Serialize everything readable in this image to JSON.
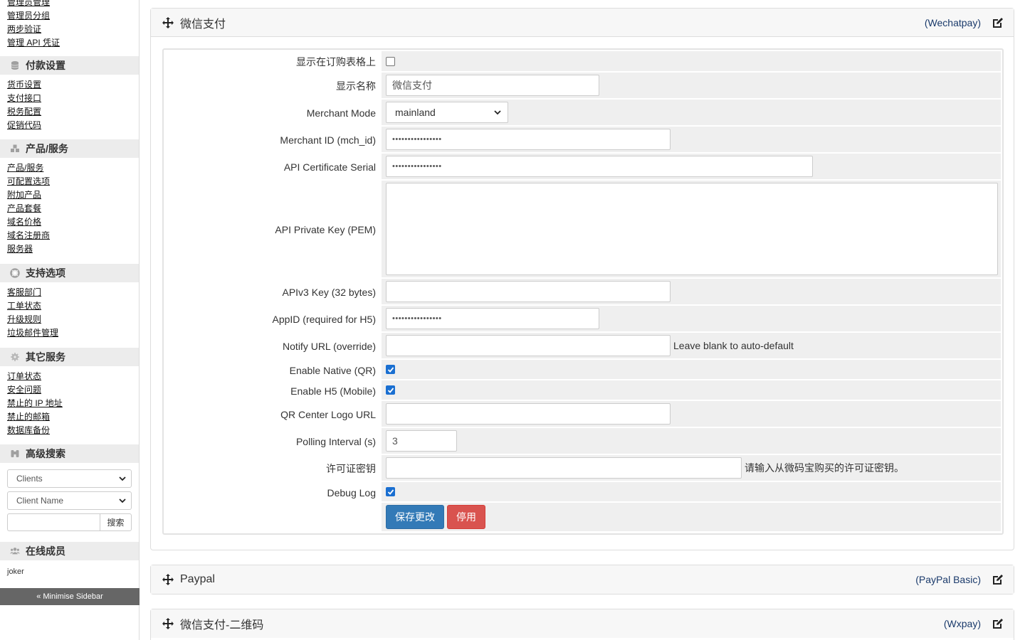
{
  "sidebar": {
    "top_links": [
      "管理员管理",
      "管理员分组",
      "两步验证",
      "管理 API 凭证"
    ],
    "sections": [
      {
        "title": "付款设置",
        "icon": "coins-icon",
        "links": [
          "货币设置",
          "支付接口",
          "税务配置",
          "促销代码"
        ]
      },
      {
        "title": "产品/服务",
        "icon": "cubes-icon",
        "links": [
          "产品/服务",
          "可配置选项",
          "附加产品",
          "产品套餐",
          "域名价格",
          "域名注册商",
          "服务器"
        ]
      },
      {
        "title": "支持选项",
        "icon": "lifebuoy-icon",
        "links": [
          "客服部门",
          "工单状态",
          "升级规则",
          "垃圾邮件管理"
        ]
      },
      {
        "title": "其它服务",
        "icon": "cogs-icon",
        "links": [
          "订单状态",
          "安全问题",
          "禁止的 IP 地址",
          "禁止的邮箱",
          "数据库备份"
        ]
      }
    ],
    "advanced_search": {
      "title": "高级搜索",
      "type_select": "Clients",
      "field_select": "Client Name",
      "search_value": "",
      "search_button": "搜索"
    },
    "online": {
      "title": "在线成员",
      "users": [
        "joker"
      ]
    },
    "minimise": "« Minimise Sidebar"
  },
  "panels": [
    {
      "title": "微信支付",
      "module": "(Wechatpay)"
    },
    {
      "title": "Paypal",
      "module": "(PayPal Basic)"
    },
    {
      "title": "微信支付-二维码",
      "module": "(Wxpay)"
    }
  ],
  "form": {
    "show_on_order_label": "显示在订购表格上",
    "show_on_order": false,
    "display_name_label": "显示名称",
    "display_name": "微信支付",
    "merchant_mode_label": "Merchant Mode",
    "merchant_mode": "mainland",
    "merchant_id_label": "Merchant ID (mch_id)",
    "merchant_id": "••••••••••••••••",
    "cert_serial_label": "API Certificate Serial",
    "cert_serial": "••••••••••••••••",
    "private_key_label": "API Private Key (PEM)",
    "private_key": "",
    "apiv3_label": "APIv3 Key (32 bytes)",
    "apiv3": "",
    "appid_label": "AppID (required for H5)",
    "appid": "••••••••••••••••",
    "notify_label": "Notify URL (override)",
    "notify": "",
    "notify_hint": "Leave blank to auto-default",
    "native_label": "Enable Native (QR)",
    "native": true,
    "h5_label": "Enable H5 (Mobile)",
    "h5": true,
    "logo_label": "QR Center Logo URL",
    "logo": "",
    "polling_label": "Polling Interval (s)",
    "polling": "3",
    "license_label": "许可证密钥",
    "license": "",
    "license_hint": "请输入从微码宝购买的许可证密钥。",
    "debug_label": "Debug Log",
    "debug": true,
    "save_button": "保存更改",
    "deactivate_button": "停用"
  },
  "colors": {
    "save": "#337ab7",
    "deactivate": "#d9534f",
    "accent_link": "#1a3a6b"
  }
}
